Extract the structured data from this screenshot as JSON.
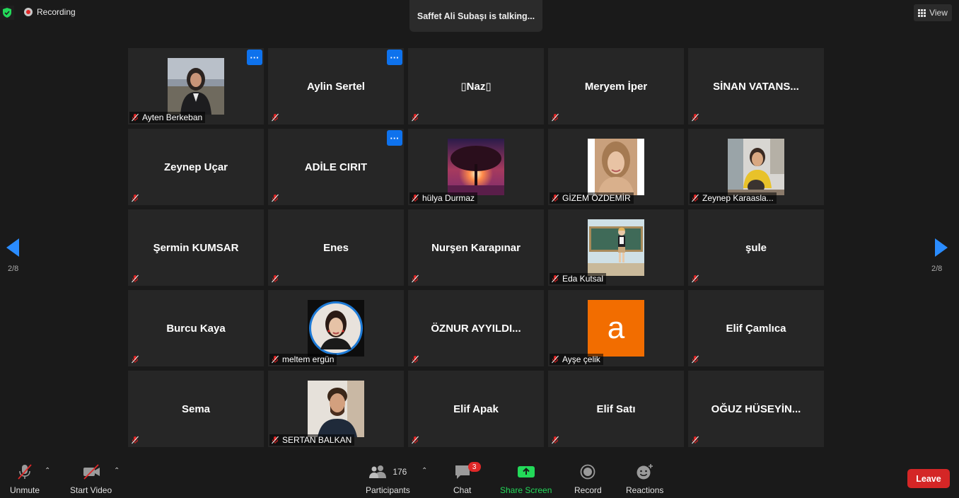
{
  "top": {
    "recording_label": "Recording",
    "talking_text": "Saffet Ali Subaşı is talking...",
    "view_label": "View"
  },
  "pagination": {
    "left_page": "2/8",
    "right_page": "2/8"
  },
  "participants": [
    {
      "name": "Ayten Berkeban",
      "display": "",
      "photo": "woman-jacket-photo",
      "more": true
    },
    {
      "name": "",
      "display": "Aylin Sertel",
      "photo": "",
      "more": true
    },
    {
      "name": "",
      "display": "▯Naz▯",
      "photo": "",
      "more": false
    },
    {
      "name": "",
      "display": "Meryem İper",
      "photo": "",
      "more": false
    },
    {
      "name": "",
      "display": "SİNAN VATANS...",
      "photo": "",
      "more": false
    },
    {
      "name": "",
      "display": "Zeynep Uçar",
      "photo": "",
      "more": false
    },
    {
      "name": "",
      "display": "ADİLE CIRIT",
      "photo": "",
      "more": true
    },
    {
      "name": "hülya Durmaz",
      "display": "",
      "photo": "sunset-tree-photo",
      "more": false
    },
    {
      "name": "GİZEM ÖZDEMİR",
      "display": "",
      "photo": "woman-portrait-photo",
      "more": false
    },
    {
      "name": "Zeynep Karaasla...",
      "display": "",
      "photo": "woman-yellow-photo",
      "more": false
    },
    {
      "name": "",
      "display": "Şermin KUMSAR",
      "photo": "",
      "more": false
    },
    {
      "name": "",
      "display": "Enes",
      "photo": "",
      "more": false
    },
    {
      "name": "",
      "display": "Nurşen Karapınar",
      "photo": "",
      "more": false
    },
    {
      "name": "Eda Kutsal",
      "display": "",
      "photo": "teacher-cartoon-photo",
      "more": false
    },
    {
      "name": "",
      "display": "şule",
      "photo": "",
      "more": false
    },
    {
      "name": "",
      "display": "Burcu Kaya",
      "photo": "",
      "more": false
    },
    {
      "name": "meltem ergün",
      "display": "",
      "photo": "circle-portrait-photo",
      "more": false
    },
    {
      "name": "",
      "display": "ÖZNUR AYYILDI...",
      "photo": "",
      "more": false
    },
    {
      "name": "Ayşe çelik",
      "display": "",
      "photo": "letter-avatar",
      "avatar_letter": "a",
      "more": false
    },
    {
      "name": "",
      "display": "Elif Çamlıca",
      "photo": "",
      "more": false
    },
    {
      "name": "",
      "display": "Sema",
      "photo": "",
      "more": false
    },
    {
      "name": "SERTAN BALKAN",
      "display": "",
      "photo": "man-portrait-photo",
      "more": false
    },
    {
      "name": "",
      "display": "Elif Apak",
      "photo": "",
      "more": false
    },
    {
      "name": "",
      "display": "Elif Satı",
      "photo": "",
      "more": false
    },
    {
      "name": "",
      "display": "OĞUZ  HÜSEYİN...",
      "photo": "",
      "more": false
    }
  ],
  "more_label": "···",
  "toolbar": {
    "unmute_label": "Unmute",
    "start_video_label": "Start Video",
    "participants_label": "Participants",
    "participants_count": "176",
    "chat_label": "Chat",
    "chat_badge": "3",
    "share_label": "Share Screen",
    "record_label": "Record",
    "reactions_label": "Reactions",
    "leave_label": "Leave"
  },
  "colors": {
    "accent_blue": "#0e72ed",
    "share_green": "#23d959",
    "leave_red": "#d42626",
    "avatar_orange": "#f26d00",
    "tile_bg": "#262626",
    "page_bg": "#1a1a1a"
  }
}
